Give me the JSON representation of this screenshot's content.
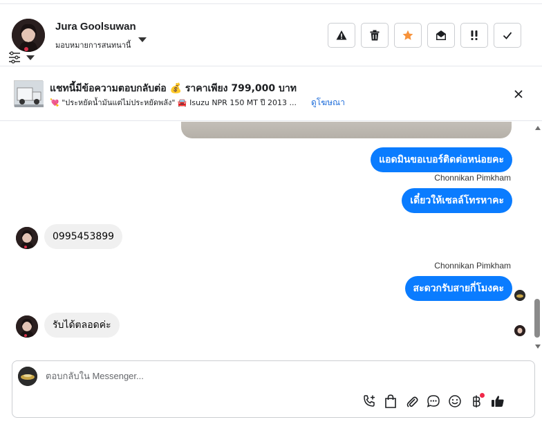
{
  "header": {
    "name": "Jura Goolsuwan",
    "assign_label": "มอบหมายการสนทนานี้"
  },
  "actions": [
    {
      "name": "report-button",
      "icon": "warning-icon"
    },
    {
      "name": "delete-button",
      "icon": "trash-icon"
    },
    {
      "name": "star-button",
      "icon": "star-icon",
      "color": "#f7923a"
    },
    {
      "name": "mark-unread-button",
      "icon": "envelope-open-icon"
    },
    {
      "name": "follow-up-button",
      "icon": "exclamation-icon"
    },
    {
      "name": "mark-done-button",
      "icon": "check-icon"
    }
  ],
  "ad": {
    "title": "แชทนี้มีข้อความตอบกลับต่อ 💰 ราคาเพียง 799,000 บาท",
    "subtitle": "💘 \"ประหยัดน้ำมันแต่ไม่ประหยัดพลัง\" 🚘 Isuzu NPR 150 MT ปี 2013 ...",
    "link": "ดูโฆษณา"
  },
  "messages": {
    "out_1": "แอดมินขอเบอร์ติดต่อหน่อยคะ",
    "sender_1": "Chonnikan Pimkham",
    "out_2": "เดี๋ยวให้เซลล์โทรหาคะ",
    "in_1": "0995453899",
    "sender_2": "Chonnikan Pimkham",
    "out_3": "สะดวกรับสายกี่โมงคะ",
    "in_2": "รับได้ตลอดค่ะ"
  },
  "composer": {
    "placeholder": "ตอบกลับใน Messenger..."
  },
  "colors": {
    "outgoing_bubble": "#0a7cff",
    "incoming_bubble": "#f0f0f0",
    "link": "#216fdb",
    "like": "#0a7cff"
  }
}
